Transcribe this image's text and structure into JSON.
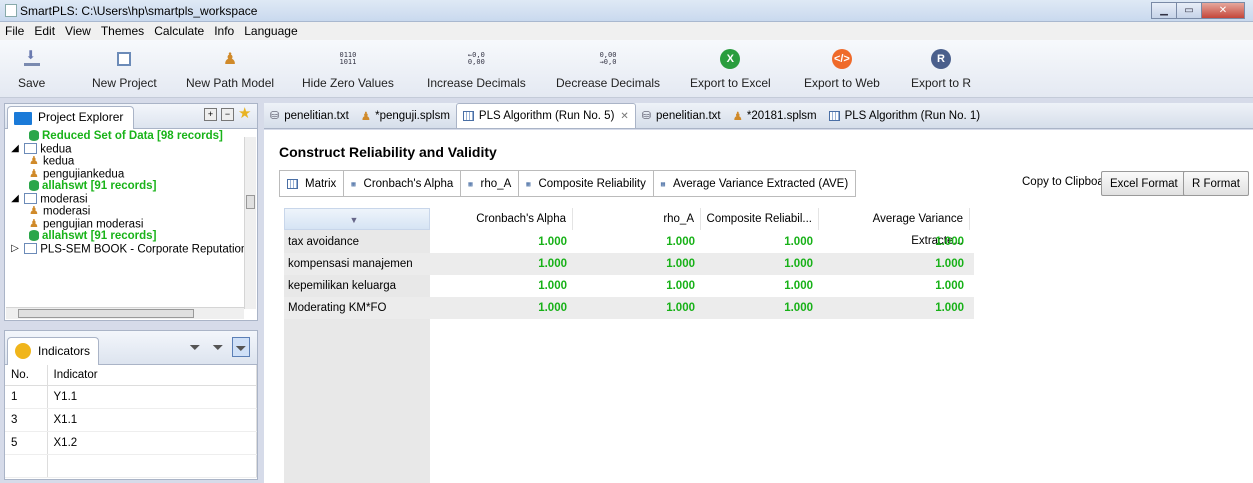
{
  "window": {
    "title": "SmartPLS: C:\\Users\\hp\\smartpls_workspace"
  },
  "menu": [
    "File",
    "Edit",
    "View",
    "Themes",
    "Calculate",
    "Info",
    "Language"
  ],
  "toolbar": {
    "save": "Save",
    "new_project": "New Project",
    "new_path_model": "New Path Model",
    "hide_zero": "Hide Zero Values",
    "increase_decimals": "Increase Decimals",
    "decrease_decimals": "Decrease Decimals",
    "export_excel": "Export to Excel",
    "export_web": "Export to Web",
    "export_r": "Export to R",
    "bin_icon_text": "0110\n1011",
    "inc_icon_text": "←0,0\n0,00",
    "dec_icon_text": "0,00\n→0,0"
  },
  "explorer": {
    "tab_label": "Project Explorer",
    "rows": [
      {
        "text": "Reduced Set of Data [98 records]",
        "kind": "data",
        "indent": 2
      },
      {
        "text": "kedua",
        "kind": "project",
        "indent": 0,
        "expanded": true
      },
      {
        "text": "kedua",
        "kind": "model",
        "indent": 2
      },
      {
        "text": "pengujiankedua",
        "kind": "model",
        "indent": 2
      },
      {
        "text": "allahswt [91 records]",
        "kind": "data",
        "indent": 2
      },
      {
        "text": "moderasi",
        "kind": "project",
        "indent": 0,
        "expanded": true
      },
      {
        "text": "moderasi",
        "kind": "model",
        "indent": 2
      },
      {
        "text": "pengujian moderasi",
        "kind": "model",
        "indent": 2
      },
      {
        "text": "allahswt [91 records]",
        "kind": "data",
        "indent": 2
      },
      {
        "text": "PLS-SEM BOOK - Corporate Reputation",
        "kind": "project",
        "indent": 0,
        "expanded": false
      }
    ]
  },
  "indicators": {
    "tab_label": "Indicators",
    "headers": [
      "No.",
      "Indicator"
    ],
    "rows": [
      [
        "1",
        "Y1.1"
      ],
      [
        "3",
        "X1.1"
      ],
      [
        "5",
        "X1.2"
      ]
    ]
  },
  "editor_tabs": [
    {
      "label": "penelitian.txt",
      "icon": "db",
      "active": false
    },
    {
      "label": "*penguji.splsm",
      "icon": "model",
      "active": false
    },
    {
      "label": "PLS Algorithm (Run No. 5)",
      "icon": "grid",
      "active": true
    },
    {
      "label": "penelitian.txt",
      "icon": "db",
      "active": false
    },
    {
      "label": "*20181.splsm",
      "icon": "model",
      "active": false
    },
    {
      "label": "PLS Algorithm (Run No. 1)",
      "icon": "grid",
      "active": false
    }
  ],
  "report": {
    "title": "Construct Reliability and Validity",
    "tabs": [
      "Matrix",
      "Cronbach's Alpha",
      "rho_A",
      "Composite Reliability",
      "Average Variance Extracted (AVE)"
    ],
    "copy_label": "Copy to Clipboard:",
    "excel_btn": "Excel Format",
    "r_btn": "R Format",
    "columns": [
      "Cronbach's Alpha",
      "rho_A",
      "Composite Reliabil...",
      "Average Variance Extracte..."
    ],
    "rows": [
      {
        "label": "tax avoidance",
        "values": [
          "1.000",
          "1.000",
          "1.000",
          "1.000"
        ]
      },
      {
        "label": "kompensasi manajemen",
        "values": [
          "1.000",
          "1.000",
          "1.000",
          "1.000"
        ]
      },
      {
        "label": "kepemilikan keluarga",
        "values": [
          "1.000",
          "1.000",
          "1.000",
          "1.000"
        ]
      },
      {
        "label": "Moderating KM*FO",
        "values": [
          "1.000",
          "1.000",
          "1.000",
          "1.000"
        ]
      }
    ]
  }
}
